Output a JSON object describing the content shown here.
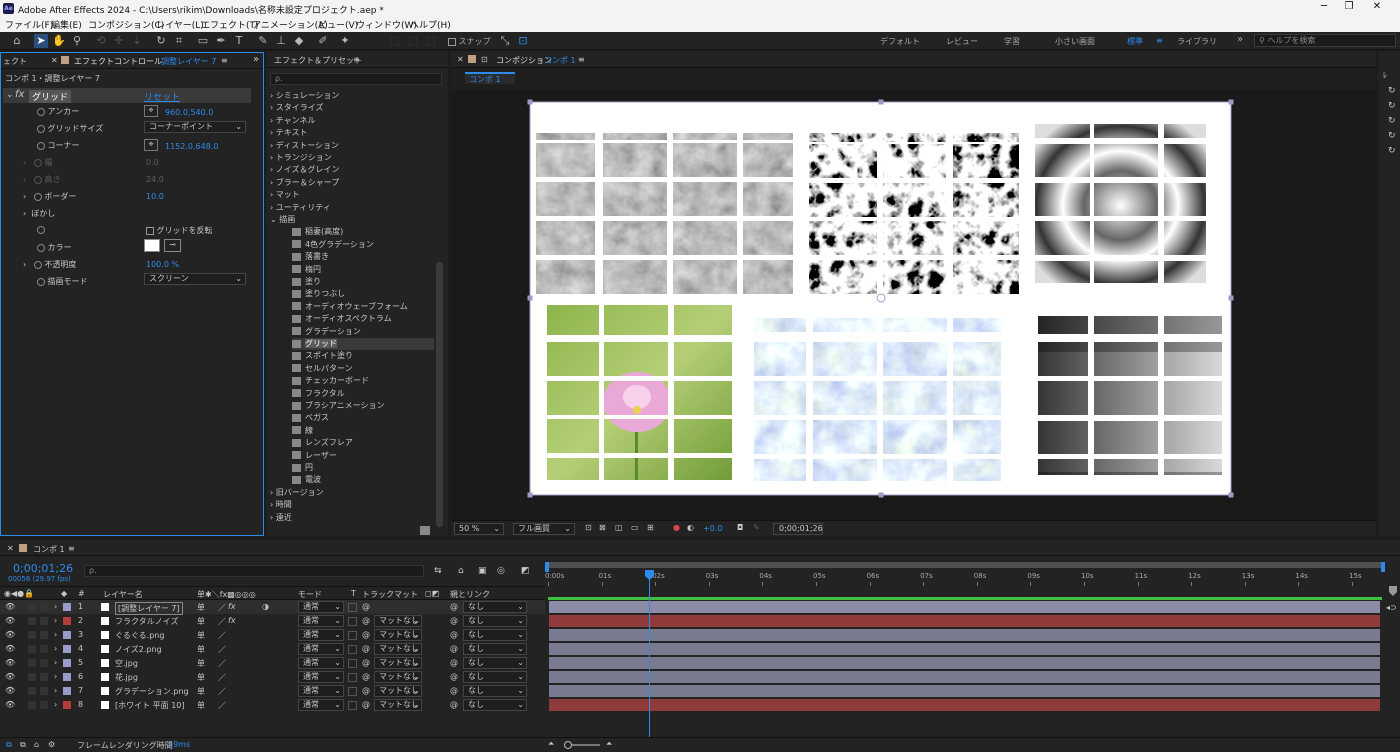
{
  "app": {
    "title": "Adobe After Effects 2024 - C:\\Users\\rikim\\Downloads\\名称未設定プロジェクト.aep *",
    "logo": "Ae"
  },
  "menu": [
    "ファイル(F)",
    "編集(E)",
    "コンポジション(C)",
    "レイヤー(L)",
    "エフェクト(T)",
    "アニメーション(A)",
    "ビュー(V)",
    "ウィンドウ(W)",
    "ヘルプ(H)"
  ],
  "toolbar": {
    "snap": "スナップ",
    "workspaces": [
      "デフォルト",
      "レビュー",
      "学習",
      "小さい画面",
      "標準",
      "ライブラリ"
    ],
    "help_placeholder": "ヘルプを検索"
  },
  "effect_controls": {
    "tab_prev": "ェクト",
    "tab": "エフェクトコントロール",
    "tab_layer": "調整レイヤー 7",
    "breadcrumb": "コンポ 1・調整レイヤー 7",
    "effect_name": "グリッド",
    "reset": "リセット",
    "props": [
      {
        "label": "アンカー",
        "value": "960.0,540.0"
      },
      {
        "label": "グリッドサイズ",
        "value": "コーナーポイント"
      },
      {
        "label": "コーナー",
        "value": "1152.0,648.0"
      },
      {
        "label": "幅",
        "value": "0.0"
      },
      {
        "label": "高さ",
        "value": "24.0"
      },
      {
        "label": "ボーダー",
        "value": "10.0"
      },
      {
        "label": "ぼかし",
        "value": ""
      },
      {
        "label": "",
        "value": "グリッドを反転"
      },
      {
        "label": "カラー",
        "value": ""
      },
      {
        "label": "不透明度",
        "value": "100.0 %"
      },
      {
        "label": "描画モード",
        "value": "スクリーン"
      }
    ]
  },
  "effects_presets": {
    "title": "エフェクト＆プリセット",
    "search_placeholder": "ρ.",
    "categories": [
      "シミュレーション",
      "スタイライズ",
      "チャンネル",
      "テキスト",
      "ディストーション",
      "トランジション",
      "ノイズ＆グレイン",
      "ブラー＆シャープ",
      "マット",
      "ユーティリティ",
      "描画"
    ],
    "items": [
      "稲妻(高度)",
      "4色グラデーション",
      "落書き",
      "楕円",
      "塗り",
      "塗りつぶし",
      "オーディオウェーブフォーム",
      "オーディオスペクトラム",
      "グラデーション",
      "グリッド",
      "スポイト塗り",
      "セルパターン",
      "チェッカーボード",
      "フラクタル",
      "ブラシアニメーション",
      "ベガス",
      "線",
      "レンズフレア",
      "レーザー",
      "円",
      "電波"
    ],
    "bottom": [
      "旧バージョン",
      "時間",
      "遠近"
    ]
  },
  "composition": {
    "title": "コンポジション",
    "comp_name": "コンポ 1",
    "tab": "コンポ 1",
    "zoom": "50 %",
    "resolution": "フル画質",
    "exposure": "+0.0",
    "timecode": "0;00;01;26"
  },
  "timeline": {
    "comp_tab": "コンポ 1",
    "timecode": "0;00;01;26",
    "frame_info": "00056 (29.97 fps)",
    "headers": {
      "layer_name": "レイヤー名",
      "mode": "モード",
      "t": "T",
      "trackmatte": "トラックマット",
      "parent": "親とリンク"
    },
    "layers": [
      {
        "num": "1",
        "name": "[調整レイヤー 7]",
        "color": "#9b9bc8",
        "mode": "通常",
        "matte": "",
        "parent": "なし",
        "bar": "#8c8ca6"
      },
      {
        "num": "2",
        "name": "フラクタルノイズ",
        "color": "#b43c3c",
        "mode": "通常",
        "matte": "マットなし",
        "parent": "なし",
        "bar": "#8f3b3b"
      },
      {
        "num": "3",
        "name": "ぐるぐる.png",
        "color": "#9b9bc8",
        "mode": "通常",
        "matte": "マットなし",
        "parent": "なし",
        "bar": "#7a7a90"
      },
      {
        "num": "4",
        "name": "ノイズ2.png",
        "color": "#9b9bc8",
        "mode": "通常",
        "matte": "マットなし",
        "parent": "なし",
        "bar": "#7a7a90"
      },
      {
        "num": "5",
        "name": "空.jpg",
        "color": "#9b9bc8",
        "mode": "通常",
        "matte": "マットなし",
        "parent": "なし",
        "bar": "#7a7a90"
      },
      {
        "num": "6",
        "name": "花.jpg",
        "color": "#9b9bc8",
        "mode": "通常",
        "matte": "マットなし",
        "parent": "なし",
        "bar": "#7a7a90"
      },
      {
        "num": "7",
        "name": "グラデーション.png",
        "color": "#9b9bc8",
        "mode": "通常",
        "matte": "マットなし",
        "parent": "なし",
        "bar": "#7a7a90"
      },
      {
        "num": "8",
        "name": "[ホワイト 平面 10]",
        "color": "#b43c3c",
        "mode": "通常",
        "matte": "マットなし",
        "parent": "なし",
        "bar": "#8f3b3b"
      }
    ],
    "ruler": [
      "0:00s",
      "01s",
      "02s",
      "03s",
      "04s",
      "05s",
      "06s",
      "07s",
      "08s",
      "09s",
      "10s",
      "11s",
      "12s",
      "13s",
      "14s",
      "15s"
    ],
    "footer": {
      "render_label": "フレームレンダリング時間",
      "render_value": "19ms"
    }
  }
}
